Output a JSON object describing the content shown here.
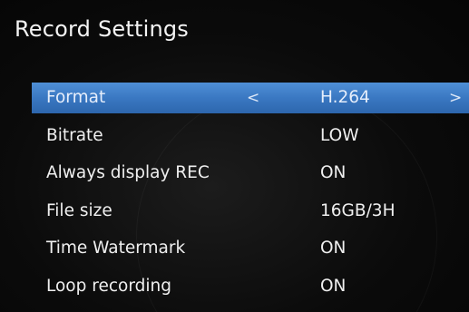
{
  "header": {
    "title": "Record Settings"
  },
  "menu": {
    "selected_index": 0,
    "arrows": {
      "left": "<",
      "right": ">"
    },
    "items": [
      {
        "label": "Format",
        "value": "H.264"
      },
      {
        "label": "Bitrate",
        "value": "LOW"
      },
      {
        "label": "Always display REC",
        "value": "ON"
      },
      {
        "label": "File size",
        "value": "16GB/3H"
      },
      {
        "label": "Time Watermark",
        "value": "ON"
      },
      {
        "label": "Loop recording",
        "value": "ON"
      }
    ]
  },
  "colors": {
    "highlight": "#3a78c2",
    "background": "#0b0b0b",
    "text": "#efefef"
  }
}
